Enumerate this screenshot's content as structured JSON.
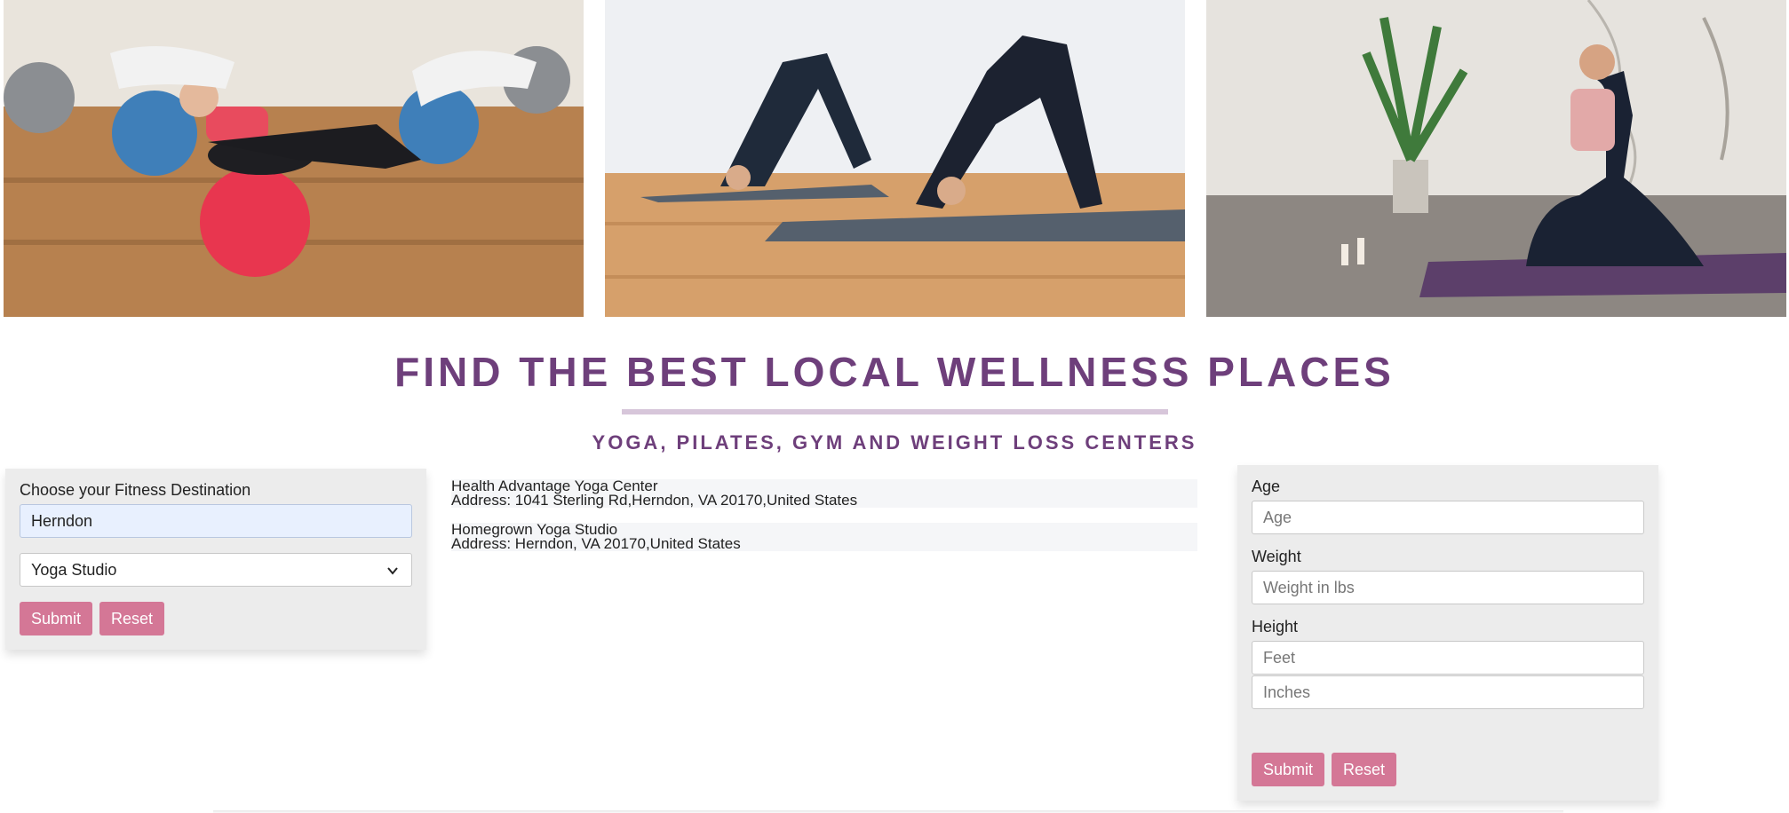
{
  "heading": {
    "title": "FIND THE BEST LOCAL WELLNESS PLACES",
    "subtitle": "YOGA, PILATES, GYM AND WEIGHT LOSS CENTERS"
  },
  "colors": {
    "accent": "#6e3f7b",
    "button": "#d47796",
    "panel": "#ececec"
  },
  "search": {
    "label": "Choose your Fitness Destination",
    "location_value": "Herndon",
    "category_selected": "Yoga Studio",
    "submit_label": "Submit",
    "reset_label": "Reset"
  },
  "results": [
    {
      "name": "Health Advantage Yoga Center",
      "address": "Address: 1041 Sterling Rd,Herndon, VA 20170,United States"
    },
    {
      "name": "Homegrown Yoga Studio",
      "address": "Address: Herndon, VA 20170,United States"
    }
  ],
  "bmi": {
    "age_label": "Age",
    "age_placeholder": "Age",
    "weight_label": "Weight",
    "weight_placeholder": "Weight in lbs",
    "height_label": "Height",
    "feet_placeholder": "Feet",
    "inches_placeholder": "Inches",
    "submit_label": "Submit",
    "reset_label": "Reset"
  },
  "icons": {
    "dropdown": "chevron-down-icon"
  }
}
